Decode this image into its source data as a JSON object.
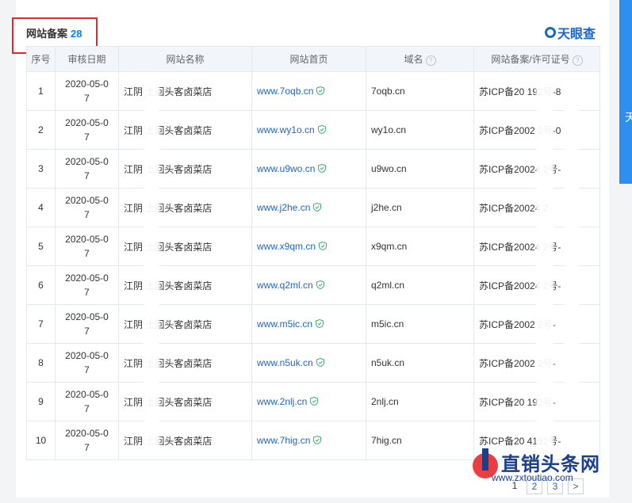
{
  "section": {
    "title": "网站备案",
    "count": "28"
  },
  "brand": {
    "logo_text": "天眼查"
  },
  "side_tab": {
    "label": "天"
  },
  "table": {
    "headers": [
      "序号",
      "审核日期",
      "网站名称",
      "网站首页",
      "域名",
      "网站备案/许可证号"
    ],
    "rows": [
      {
        "idx": "1",
        "date_line1": "2020-05-0",
        "date_line2": "7",
        "name": "江阴 土回头客卤菜店",
        "home": "www.7oqb.cn",
        "domain": "7oqb.cn",
        "icp": "苏ICP备20 192号-8"
      },
      {
        "idx": "2",
        "date_line1": "2020-05-0",
        "date_line2": "7",
        "name": "江阴 土回头客卤菜店",
        "home": "www.wy1o.cn",
        "domain": "wy1o.cn",
        "icp": "苏ICP备2002 2号-0"
      },
      {
        "idx": "3",
        "date_line1": "2020-05-0",
        "date_line2": "7",
        "name": "江阴 土回头客卤菜店",
        "home": "www.u9wo.cn",
        "domain": "u9wo.cn",
        "icp": "苏ICP备20024 2号-"
      },
      {
        "idx": "4",
        "date_line1": "2020-05-0",
        "date_line2": "7",
        "name": "江阴 土回头客卤菜店",
        "home": "www.j2he.cn",
        "domain": "j2he.cn",
        "icp": "苏ICP备20024 2"
      },
      {
        "idx": "5",
        "date_line1": "2020-05-0",
        "date_line2": "7",
        "name": "江阴 土回头客卤菜店",
        "home": "www.x9qm.cn",
        "domain": "x9qm.cn",
        "icp": "苏ICP备20024 2号-"
      },
      {
        "idx": "6",
        "date_line1": "2020-05-0",
        "date_line2": "7",
        "name": "江阴 土回头客卤菜店",
        "home": "www.q2ml.cn",
        "domain": "q2ml.cn",
        "icp": "苏ICP备20024 2号-"
      },
      {
        "idx": "7",
        "date_line1": "2020-05-0",
        "date_line2": "7",
        "name": "江阴 土回头客卤菜店",
        "home": "www.m5ic.cn",
        "domain": "m5ic.cn",
        "icp": "苏ICP备2002 2号-"
      },
      {
        "idx": "8",
        "date_line1": "2020-05-0",
        "date_line2": "7",
        "name": "江阴 土回头客卤菜店",
        "home": "www.n5uk.cn",
        "domain": "n5uk.cn",
        "icp": "苏ICP备2002 2号-"
      },
      {
        "idx": "9",
        "date_line1": "2020-05-0",
        "date_line2": "7",
        "name": "江阴 土回头客卤菜店",
        "home": "www.2nlj.cn",
        "domain": "2nlj.cn",
        "icp": "苏ICP备20 192号-"
      },
      {
        "idx": "10",
        "date_line1": "2020-05-0",
        "date_line2": "7",
        "name": "江阴 土回头客卤菜店",
        "home": "www.7hig.cn",
        "domain": "7hig.cn",
        "icp": "苏ICP备20 4192号-"
      }
    ]
  },
  "pagination": {
    "pages": [
      "1",
      "2",
      "3",
      ">"
    ]
  },
  "watermark": {
    "brand": "直销头条网",
    "url": "www.zxtoutiao.com"
  },
  "colors": {
    "accent": "#1b66c9",
    "highlight": "#e8292b",
    "shield": "#3cb371"
  }
}
